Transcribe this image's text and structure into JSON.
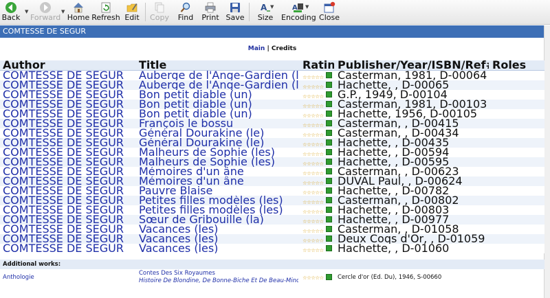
{
  "toolbar": {
    "buttons": [
      {
        "label": "Back",
        "icon": "back-arrow-icon",
        "enabled": true
      },
      {
        "label": "Forward",
        "icon": "forward-arrow-icon",
        "enabled": false
      },
      {
        "label": "Home",
        "icon": "home-icon",
        "enabled": true
      },
      {
        "label": "Refresh",
        "icon": "refresh-icon",
        "enabled": true
      },
      {
        "label": "Edit",
        "icon": "pencil-folder-icon",
        "enabled": true
      },
      {
        "label": "Copy",
        "icon": "copy-icon",
        "enabled": false
      },
      {
        "label": "Find",
        "icon": "magnifier-icon",
        "enabled": true
      },
      {
        "label": "Print",
        "icon": "printer-icon",
        "enabled": true
      },
      {
        "label": "Save",
        "icon": "floppy-disk-icon",
        "enabled": true
      },
      {
        "label": "Size",
        "icon": "text-size-icon",
        "enabled": true
      },
      {
        "label": "Encoding",
        "icon": "encoding-icon",
        "enabled": true
      },
      {
        "label": "Close",
        "icon": "close-window-icon",
        "enabled": true
      }
    ]
  },
  "page": {
    "title": "COMTESSE DE SEGUR",
    "nav_main": "Main",
    "nav_sep": "|",
    "nav_credits": "Credits"
  },
  "colors": {
    "title_bar": "#3d6fb6",
    "link": "#1f2fa8",
    "star": "#d9a520",
    "rating_box": "#2f9b2f"
  },
  "table": {
    "headers": {
      "author": "Author",
      "title": "Title",
      "rating": "Rating",
      "publisher": "Publisher/Year/ISBN/Ref#",
      "roles": "Roles"
    },
    "rows": [
      {
        "author": "COMTESSE DE SEGUR",
        "title": "Auberge de l'Ange-Gardien (l')",
        "publisher": "Casterman, 1981, D-00064",
        "roles": ""
      },
      {
        "author": "COMTESSE DE SEGUR",
        "title": "Auberge de l'Ange-Gardien (l')",
        "publisher": "Hachette, , D-00065",
        "roles": ""
      },
      {
        "author": "COMTESSE DE SEGUR",
        "title": "Bon petit diable (un)",
        "publisher": "G.P., 1949, D-00104",
        "roles": ""
      },
      {
        "author": "COMTESSE DE SEGUR",
        "title": "Bon petit diable (un)",
        "publisher": "Casterman, 1981, D-00103",
        "roles": ""
      },
      {
        "author": "COMTESSE DE SEGUR",
        "title": "Bon petit diable (un)",
        "publisher": "Hachette, 1956, D-00105",
        "roles": ""
      },
      {
        "author": "COMTESSE DE SEGUR",
        "title": "François le bossu",
        "publisher": "Casterman, , D-00415",
        "roles": ""
      },
      {
        "author": "COMTESSE DE SEGUR",
        "title": "Général Dourakine (le)",
        "publisher": "Casterman, , D-00434",
        "roles": ""
      },
      {
        "author": "COMTESSE DE SEGUR",
        "title": "Général Dourakine (le)",
        "publisher": "Hachette, , D-00435",
        "roles": ""
      },
      {
        "author": "COMTESSE DE SEGUR",
        "title": "Malheurs de Sophie (les)",
        "publisher": "Hachette, , D-00594",
        "roles": ""
      },
      {
        "author": "COMTESSE DE SEGUR",
        "title": "Malheurs de Sophie (les)",
        "publisher": "Hachette, , D-00595",
        "roles": ""
      },
      {
        "author": "COMTESSE DE SEGUR",
        "title": "Mémoires d'un âne",
        "publisher": "Casterman, , D-00623",
        "roles": ""
      },
      {
        "author": "COMTESSE DE SEGUR",
        "title": "Mémoires d'un âne",
        "publisher": "DUVAL Paul, , D-00624",
        "roles": ""
      },
      {
        "author": "COMTESSE DE SEGUR",
        "title": "Pauvre Blaise",
        "publisher": "Hachette, , D-00782",
        "roles": ""
      },
      {
        "author": "COMTESSE DE SEGUR",
        "title": "Petites filles modèles (les)",
        "publisher": "Casterman, , D-00802",
        "roles": ""
      },
      {
        "author": "COMTESSE DE SEGUR",
        "title": "Petites filles modèles (les)",
        "publisher": "Hachette, , D-00803",
        "roles": ""
      },
      {
        "author": "COMTESSE DE SEGUR",
        "title": "Sœur de Gribouille (la)",
        "publisher": "Hachette, , D-00977",
        "roles": ""
      },
      {
        "author": "COMTESSE DE SEGUR",
        "title": "Vacances (les)",
        "publisher": "Casterman, , D-01058",
        "roles": ""
      },
      {
        "author": "COMTESSE DE SEGUR",
        "title": "Vacances (les)",
        "publisher": "Deux Coqs d'Or, , D-01059",
        "roles": ""
      },
      {
        "author": "COMTESSE DE SEGUR",
        "title": "Vacances (les)",
        "publisher": "Hachette, , D-01060",
        "roles": ""
      }
    ]
  },
  "additional": {
    "heading": "Additional works:",
    "rows": [
      {
        "author": "Anthologie",
        "title": "Contes Des Six Royaumes",
        "subtitle": "Histoire De Blondine, De Bonne-Biche Et De Beau-Minon",
        "publisher": "Cercle d'or (Ed. Du), 1946, S-00660",
        "roles": ""
      }
    ]
  },
  "rating_stars": "☆☆☆☆☆"
}
